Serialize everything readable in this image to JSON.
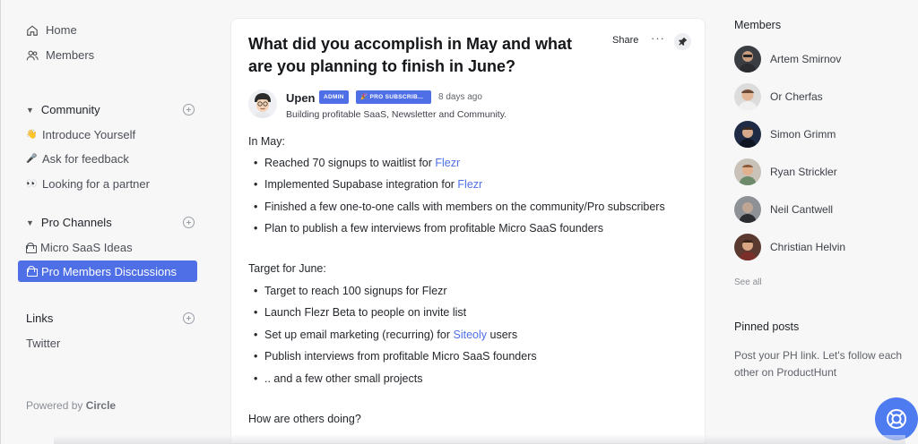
{
  "sidebar": {
    "nav": [
      {
        "label": "Home",
        "icon": "home-icon"
      },
      {
        "label": "Members",
        "icon": "members-icon"
      }
    ],
    "community": {
      "title": "Community",
      "items": [
        {
          "emoji": "👋",
          "label": "Introduce Yourself"
        },
        {
          "emoji": "🎤",
          "label": "Ask for feedback"
        },
        {
          "emoji": "👀",
          "label": "Looking for a partner"
        }
      ]
    },
    "pro_channels": {
      "title": "Pro Channels",
      "items": [
        {
          "label": "Micro SaaS Ideas"
        },
        {
          "label": "Pro Members Discussions",
          "active": true
        }
      ]
    },
    "links": {
      "title": "Links",
      "items": [
        {
          "label": "Twitter"
        }
      ]
    },
    "powered_prefix": "Powered by",
    "powered_brand": "Circle"
  },
  "post": {
    "title": "What did you accomplish in May and what are you planning to finish in June?",
    "share_label": "Share",
    "more_label": "···",
    "author": "Upen",
    "badges": [
      "ADMIN",
      "🎉 PRO SUBSCRIB..."
    ],
    "time_ago": "8 days ago",
    "headline": "Building profitable SaaS, Newsletter and Community.",
    "may_heading": "In May:",
    "may_items": [
      {
        "text": "Reached 70 signups to waitlist for ",
        "link": "Flezr",
        "after": ""
      },
      {
        "text": "Implemented Supabase integration for ",
        "link": "Flezr",
        "after": ""
      },
      {
        "text": "Finished a few one-to-one calls with members on the community/Pro subscribers",
        "link": "",
        "after": ""
      },
      {
        "text": "Plan to publish a few interviews from profitable Micro SaaS founders",
        "link": "",
        "after": ""
      }
    ],
    "june_heading": "Target for June:",
    "june_items": [
      {
        "text": "Target to reach 100 signups for Flezr",
        "link": "",
        "after": ""
      },
      {
        "text": "Launch Flezr Beta to people on invite list",
        "link": "",
        "after": ""
      },
      {
        "text": "Set up email marketing (recurring) for ",
        "link": "Siteoly",
        "after": " users"
      },
      {
        "text": "Publish interviews from profitable Micro SaaS founders",
        "link": "",
        "after": ""
      },
      {
        "text": ".. and a few other small projects",
        "link": "",
        "after": ""
      }
    ],
    "closing": "How are others doing?"
  },
  "right": {
    "members_title": "Members",
    "members": [
      {
        "name": "Artem Smirnov"
      },
      {
        "name": "Or Cherfas"
      },
      {
        "name": "Simon Grimm"
      },
      {
        "name": "Ryan Strickler"
      },
      {
        "name": "Neil Cantwell"
      },
      {
        "name": "Christian Helvin"
      }
    ],
    "see_all": "See all",
    "pinned_title": "Pinned posts",
    "pinned_text": "Post your PH link. Let's follow each other on ProductHunt"
  },
  "colors": {
    "accent": "#4f6fe6",
    "help_button": "#4f7bf0"
  }
}
